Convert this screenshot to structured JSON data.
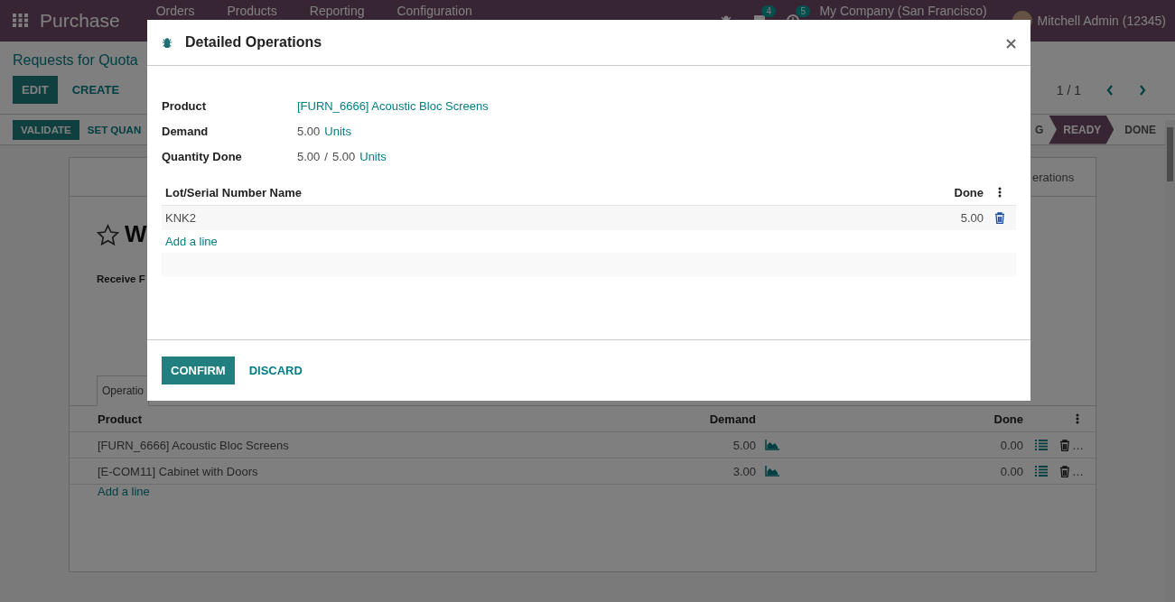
{
  "navbar": {
    "app_name": "Purchase",
    "menu": [
      "Orders",
      "Products",
      "Reporting",
      "Configuration"
    ],
    "messages_badge": "4",
    "activities_badge": "5",
    "company": "My Company (San Francisco)",
    "user": "Mitchell Admin (12345)"
  },
  "control_panel": {
    "breadcrumb": "Requests for Quota",
    "buttons": [
      {
        "label": "EDIT",
        "kind": "primary"
      },
      {
        "label": "CREATE",
        "kind": "secondary"
      }
    ],
    "pager": "1 / 1"
  },
  "status_bar": {
    "buttons": [
      {
        "label": "VALIDATE",
        "kind": "primary"
      },
      {
        "label": "SET QUAN",
        "kind": "secondary"
      }
    ],
    "stages": [
      {
        "label": "G",
        "selected": false
      },
      {
        "label": "READY",
        "selected": true
      },
      {
        "label": "DONE",
        "selected": false
      }
    ]
  },
  "sheet": {
    "smart_button": "erations",
    "starred": false,
    "title": "W",
    "field_label": "Receive F",
    "tabs": [
      {
        "label": "Operatio",
        "selected": true
      }
    ],
    "operations": {
      "columns": [
        "Product",
        "Demand",
        "Done"
      ],
      "rows": [
        {
          "product": "[FURN_6666] Acoustic Bloc Screens",
          "demand": "5.00",
          "done": "0.00",
          "overflow": "…"
        },
        {
          "product": "[E-COM11] Cabinet with Doors",
          "demand": "3.00",
          "done": "0.00",
          "overflow": "…"
        }
      ],
      "add_line": "Add a line"
    }
  },
  "dialog": {
    "title": "Detailed Operations",
    "fields": [
      {
        "label": "Product",
        "kind": "link",
        "value": "[FURN_6666] Acoustic Bloc Screens"
      },
      {
        "label": "Demand",
        "kind": "quantity",
        "value": "5.00",
        "unit": "Units"
      },
      {
        "label": "Quantity Done",
        "kind": "ratio",
        "value": "5.00",
        "separator": "/",
        "total": "5.00",
        "unit": "Units"
      }
    ],
    "table": {
      "columns": [
        "Lot/Serial Number Name",
        "Done"
      ],
      "rows": [
        {
          "lot": "KNK2",
          "done": "5.00"
        }
      ],
      "add_line": "Add a line"
    },
    "buttons": [
      {
        "label": "CONFIRM",
        "kind": "primary"
      },
      {
        "label": "DISCARD",
        "kind": "secondary"
      }
    ]
  }
}
